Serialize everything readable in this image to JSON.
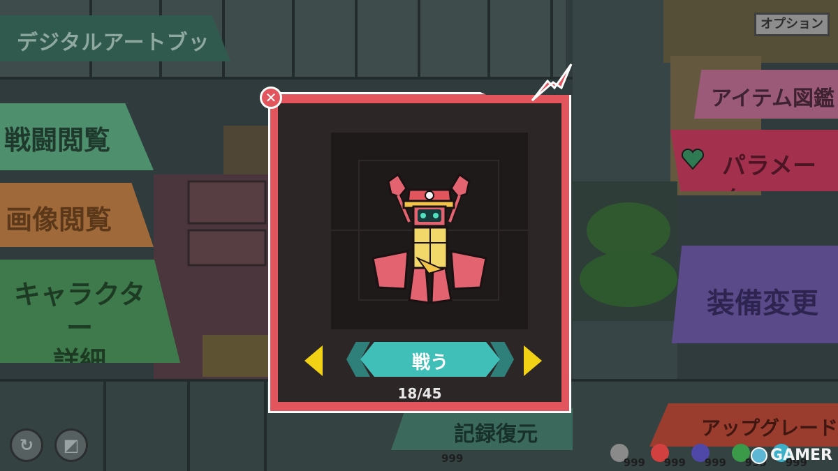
{
  "app": {
    "title": "デジタルアートブック",
    "option_label": "オプション"
  },
  "left_menu": {
    "battle_view": "戦闘閲覧",
    "image_view": "画像閲覧",
    "character_line1": "キャラクター",
    "character_line2": "詳細"
  },
  "right_menu": {
    "item_catalog": "アイテム図鑑",
    "parameter": "パラメータ",
    "equipment": "装備変更",
    "upgrade": "アップグレード"
  },
  "bottom": {
    "record_restore": "記録復元",
    "record_count": "999",
    "resources": [
      {
        "icon": "gear-icon",
        "value": "999",
        "color": "#8a8a8a"
      },
      {
        "icon": "flame-icon",
        "value": "999",
        "color": "#d2403f"
      },
      {
        "icon": "cloud-icon",
        "value": "999",
        "color": "#5048a8"
      },
      {
        "icon": "leaf-icon",
        "value": "999",
        "color": "#3a9a4a"
      },
      {
        "icon": "drop-icon",
        "value": "999",
        "color": "#3bb0c8"
      }
    ]
  },
  "modal": {
    "label": "戦う",
    "counter": "18/45",
    "close_icon": "close-icon"
  },
  "watermark": {
    "text": "GAMER"
  },
  "colors": {
    "modal_frame": "#e3555d",
    "label_pill": "#3fbfb8",
    "nav_arrow": "#f2d214"
  }
}
